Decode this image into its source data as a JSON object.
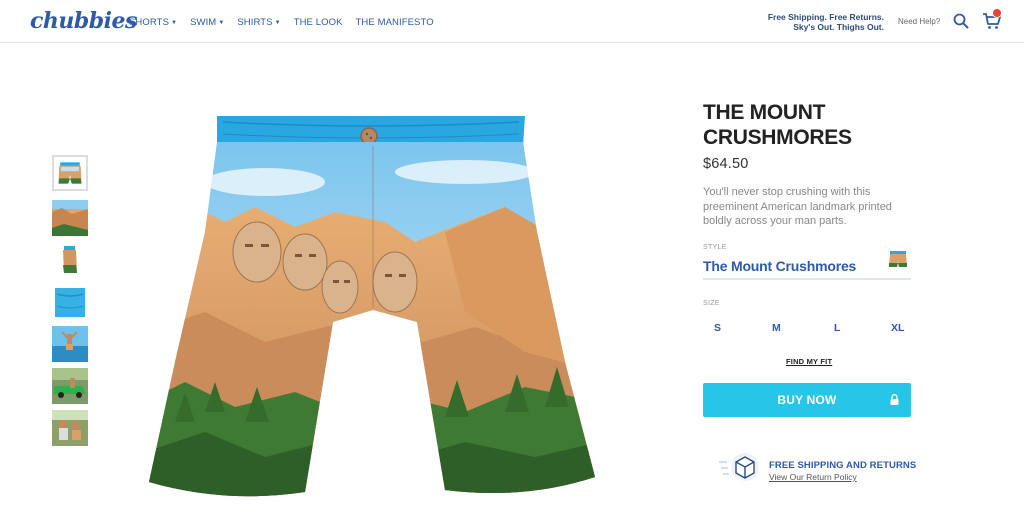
{
  "header": {
    "logo": "chubbies",
    "nav": [
      {
        "label": "SHORTS",
        "dropdown": true
      },
      {
        "label": "SWIM",
        "dropdown": true
      },
      {
        "label": "SHIRTS",
        "dropdown": true
      },
      {
        "label": "THE LOOK",
        "dropdown": false
      },
      {
        "label": "THE MANIFESTO",
        "dropdown": false
      }
    ],
    "promo_line1": "Free Shipping. Free Returns.",
    "promo_line2": "Sky's Out. Thighs Out.",
    "help_label": "Need Help?",
    "icons": {
      "search": "search-icon",
      "cart": "cart-icon"
    }
  },
  "gallery": {
    "thumbnail_count": 7,
    "active_index": 0
  },
  "product": {
    "title": "THE MOUNT CRUSHMORES",
    "price": "$64.50",
    "description": "You'll never stop crushing with this preeminent American landmark printed boldly across your man parts.",
    "style_label": "STYLE",
    "style_value": "The Mount Crushmores",
    "size_label": "SIZE",
    "sizes": [
      "S",
      "M",
      "L",
      "XL"
    ],
    "find_fit": "FIND MY FIT",
    "buy_label": "BUY NOW",
    "shipping_title": "FREE SHIPPING AND RETURNS",
    "shipping_link": "View Our Return Policy"
  },
  "colors": {
    "brand_blue": "#2e5aa8",
    "buy_button": "#26c6e8",
    "cart_badge": "#e8452c"
  }
}
